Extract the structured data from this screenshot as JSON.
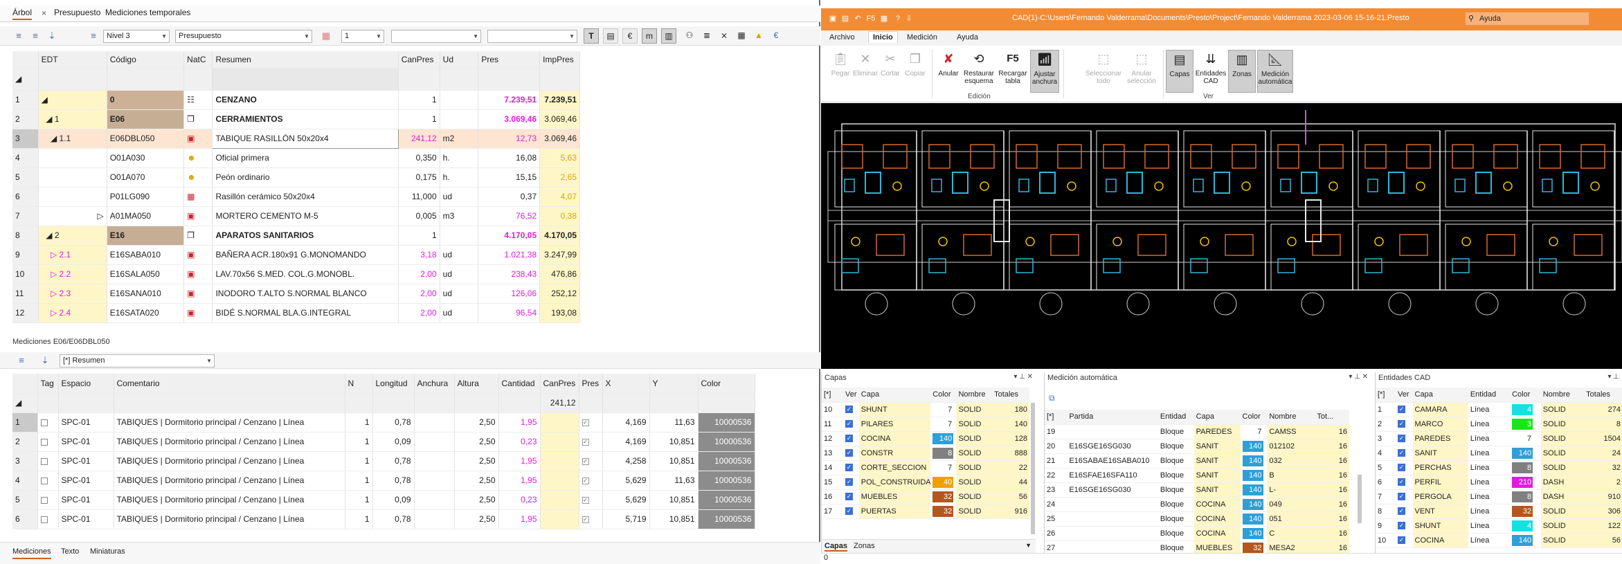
{
  "left": {
    "tabs": [
      {
        "label": "Árbol",
        "active": true
      },
      {
        "label": "Presupuesto",
        "active": false
      },
      {
        "label": "Mediciones temporales",
        "active": false
      }
    ],
    "close_glyph": "×",
    "toolbar": {
      "level_combo": "Nivel 3",
      "view_combo": "Presupuesto",
      "num_combo": "1",
      "empty_combo1": "",
      "empty_combo2": ""
    },
    "tree": {
      "headers": {
        "edt": "EDT",
        "codigo": "Código",
        "natc": "NatC",
        "resumen": "Resumen",
        "canpres": "CanPres",
        "ud": "Ud",
        "pres": "Pres",
        "imppres": "ImpPres"
      },
      "rows": [
        {
          "n": "1",
          "edt_num": "",
          "codigo": "0",
          "resumen": "CENZANO",
          "canpres": "1",
          "ud": "",
          "pres": "7.239,51",
          "imppres": "7.239,51"
        },
        {
          "n": "2",
          "edt_num": "1",
          "codigo": "E06",
          "resumen": "CERRAMIENTOS",
          "canpres": "1",
          "ud": "",
          "pres": "3.069,46",
          "imppres": "3.069,46"
        },
        {
          "n": "3",
          "edt_num": "1.1",
          "codigo": "E06DBL050",
          "resumen": "TABIQUE RASILLÓN 50x20x4",
          "canpres": "241,12",
          "ud": "m2",
          "pres": "12,73",
          "imppres": "3.069,46"
        },
        {
          "n": "4",
          "edt_num": "",
          "codigo": "O01A030",
          "resumen": "Oficial primera",
          "canpres": "0,350",
          "ud": "h.",
          "pres": "16,08",
          "imppres": "5,63"
        },
        {
          "n": "5",
          "edt_num": "",
          "codigo": "O01A070",
          "resumen": "Peón ordinario",
          "canpres": "0,175",
          "ud": "h.",
          "pres": "15,15",
          "imppres": "2,65"
        },
        {
          "n": "6",
          "edt_num": "",
          "codigo": "P01LG090",
          "resumen": "Rasillón cerámico 50x20x4",
          "canpres": "11,000",
          "ud": "ud",
          "pres": "0,37",
          "imppres": "4,07"
        },
        {
          "n": "7",
          "edt_num": "",
          "codigo": "A01MA050",
          "resumen": "MORTERO CEMENTO M-5",
          "canpres": "0,005",
          "ud": "m3",
          "pres": "76,52",
          "imppres": "0,38"
        },
        {
          "n": "8",
          "edt_num": "2",
          "codigo": "E16",
          "resumen": "APARATOS SANITARIOS",
          "canpres": "1",
          "ud": "",
          "pres": "4.170,05",
          "imppres": "4.170,05"
        },
        {
          "n": "9",
          "edt_num": "2.1",
          "codigo": "E16SABA010",
          "resumen": "BAÑERA ACR.180x91 G.MONOMANDO",
          "canpres": "3,18",
          "ud": "ud",
          "pres": "1.021,38",
          "imppres": "3.247,99"
        },
        {
          "n": "10",
          "edt_num": "2.2",
          "codigo": "E16SALA050",
          "resumen": "LAV.70x56 S.MED. COL.G.MONOBL.",
          "canpres": "2,00",
          "ud": "ud",
          "pres": "238,43",
          "imppres": "476,86"
        },
        {
          "n": "11",
          "edt_num": "2.3",
          "codigo": "E16SANA010",
          "resumen": "INODORO T.ALTO S.NORMAL BLANCO",
          "canpres": "2,00",
          "ud": "ud",
          "pres": "126,06",
          "imppres": "252,12"
        },
        {
          "n": "12",
          "edt_num": "2.4",
          "codigo": "E16SATA020",
          "resumen": "BIDÉ S.NORMAL BLA.G.INTEGRAL",
          "canpres": "2,00",
          "ud": "ud",
          "pres": "96,54",
          "imppres": "193,08"
        }
      ]
    },
    "mediciones": {
      "title": "Mediciones E06/E06DBL050",
      "combo": "[*] Resumen",
      "headers": {
        "tag": "Tag",
        "espacio": "Espacio",
        "comentario": "Comentario",
        "n": "N",
        "longitud": "Longitud",
        "anchura": "Anchura",
        "altura": "Altura",
        "cantidad": "Cantidad",
        "canpres": "CanPres",
        "pres": "Pres",
        "x": "X",
        "y": "Y",
        "color": "Color"
      },
      "canpres_total": "241,12",
      "rows": [
        {
          "n": "1",
          "espacio": "SPC-01",
          "comentario": "TABIQUES | Dormitorio principal / Cenzano | Línea",
          "nn": "1",
          "longitud": "0,78",
          "altura": "2,50",
          "cantidad": "1,95",
          "x": "4,169",
          "y": "11,63",
          "color": "10000536"
        },
        {
          "n": "2",
          "espacio": "SPC-01",
          "comentario": "TABIQUES | Dormitorio principal / Cenzano | Línea",
          "nn": "1",
          "longitud": "0,09",
          "altura": "2,50",
          "cantidad": "0,23",
          "x": "4,169",
          "y": "10,851",
          "color": "10000536"
        },
        {
          "n": "3",
          "espacio": "SPC-01",
          "comentario": "TABIQUES | Dormitorio principal / Cenzano | Línea",
          "nn": "1",
          "longitud": "0,78",
          "altura": "2,50",
          "cantidad": "1,95",
          "x": "4,258",
          "y": "10,851",
          "color": "10000536"
        },
        {
          "n": "4",
          "espacio": "SPC-01",
          "comentario": "TABIQUES | Dormitorio principal / Cenzano | Línea",
          "nn": "1",
          "longitud": "0,78",
          "altura": "2,50",
          "cantidad": "1,95",
          "x": "5,629",
          "y": "11,63",
          "color": "10000536"
        },
        {
          "n": "5",
          "espacio": "SPC-01",
          "comentario": "TABIQUES | Dormitorio principal / Cenzano | Línea",
          "nn": "1",
          "longitud": "0,09",
          "altura": "2,50",
          "cantidad": "0,23",
          "x": "5,629",
          "y": "10,851",
          "color": "10000536"
        },
        {
          "n": "6",
          "espacio": "SPC-01",
          "comentario": "TABIQUES | Dormitorio principal / Cenzano | Línea",
          "nn": "1",
          "longitud": "0,78",
          "altura": "2,50",
          "cantidad": "1,95",
          "x": "5,719",
          "y": "10,851",
          "color": "10000536"
        }
      ]
    },
    "bottom_tabs": [
      {
        "label": "Mediciones",
        "active": true
      },
      {
        "label": "Texto",
        "active": false
      },
      {
        "label": "Miniaturas",
        "active": false
      }
    ]
  },
  "right": {
    "title": "CAD(1)-C:\\Users\\Fernando Valderrama\\Documents\\Presto\\Project\\Fernando Valderrama 2023-03-06 15-16-21.Presto",
    "help_placeholder": "Ayuda",
    "ribbon_tabs": [
      {
        "label": "Archivo",
        "active": false
      },
      {
        "label": "Inicio",
        "active": true
      },
      {
        "label": "Medición",
        "active": false
      },
      {
        "label": "Ayuda",
        "active": false
      }
    ],
    "ribbon": {
      "pegar": "Pegar",
      "eliminar": "Eliminar",
      "cortar": "Cortar",
      "copiar": "Copiar",
      "anular": "Anular",
      "restaurar": "Restaurar",
      "restaurar2": "esquema",
      "recargar": "Recargar",
      "recargar2": "tabla",
      "ajustar": "Ajustar",
      "ajustar2": "anchura",
      "f5": "F5",
      "seleccionar": "Seleccionar",
      "seleccionar2": "todo",
      "anular_sel": "Anular",
      "anular_sel2": "selección",
      "capas": "Capas",
      "entidades": "Entidades",
      "entidades2": "CAD",
      "zonas": "Zonas",
      "medicion": "Medición",
      "medicion2": "automática",
      "grp_edicion": "Edición",
      "grp_ver": "Ver"
    },
    "capas_panel": {
      "title": "Capas",
      "headers": {
        "star": "[*]",
        "ver": "Ver",
        "capa": "Capa",
        "color": "Color",
        "nombre": "Nombre",
        "totales": "Totales"
      },
      "rows": [
        {
          "n": "10",
          "capa": "SHUNT",
          "color": "7",
          "sw": "",
          "nombre": "SOLID",
          "tot": "180"
        },
        {
          "n": "11",
          "capa": "PILARES",
          "color": "7",
          "sw": "",
          "nombre": "SOLID",
          "tot": "140"
        },
        {
          "n": "12",
          "capa": "COCINA",
          "color": "140",
          "sw": "#2f9fd8",
          "nombre": "SOLID",
          "tot": "128"
        },
        {
          "n": "13",
          "capa": "CONSTR",
          "color": "8",
          "sw": "#808080",
          "nombre": "SOLID",
          "tot": "888"
        },
        {
          "n": "14",
          "capa": "CORTE_SECCION",
          "color": "7",
          "sw": "",
          "nombre": "SOLID",
          "tot": "22"
        },
        {
          "n": "15",
          "capa": "POL_CONSTRUIDA",
          "color": "40",
          "sw": "#f0a000",
          "nombre": "SOLID",
          "tot": "44"
        },
        {
          "n": "16",
          "capa": "MUEBLES",
          "color": "32",
          "sw": "#b5561f",
          "nombre": "SOLID",
          "tot": "56"
        },
        {
          "n": "17",
          "capa": "PUERTAS",
          "color": "32",
          "sw": "#b5561f",
          "nombre": "SOLID",
          "tot": "916"
        }
      ],
      "tabs": [
        {
          "label": "Capas",
          "active": true
        },
        {
          "label": "Zonas",
          "active": false
        }
      ]
    },
    "med_auto_panel": {
      "title": "Medición automática",
      "headers": {
        "star": "[*]",
        "partida": "Partida",
        "entidad": "Entidad",
        "capa": "Capa",
        "color": "Color",
        "nombre": "Nombre",
        "tot": "Tot..."
      },
      "rows": [
        {
          "n": "19",
          "partida": "",
          "entidad": "Bloque",
          "capa": "PAREDES",
          "color": "7",
          "sw": "",
          "nombre": "CAMSS",
          "tot": "16"
        },
        {
          "n": "20",
          "partida": "E16SGE16SG030",
          "entidad": "Bloque",
          "capa": "SANIT",
          "color": "140",
          "sw": "#2f9fd8",
          "nombre": "012102",
          "tot": "16"
        },
        {
          "n": "21",
          "partida": "E16SABAE16SABA010",
          "entidad": "Bloque",
          "capa": "SANIT",
          "color": "140",
          "sw": "#2f9fd8",
          "nombre": "032",
          "tot": "16"
        },
        {
          "n": "22",
          "partida": "E16SFAE16SFA110",
          "entidad": "Bloque",
          "capa": "SANIT",
          "color": "140",
          "sw": "#2f9fd8",
          "nombre": "B",
          "tot": "16"
        },
        {
          "n": "23",
          "partida": "E16SGE16SG030",
          "entidad": "Bloque",
          "capa": "SANIT",
          "color": "140",
          "sw": "#2f9fd8",
          "nombre": "L-",
          "tot": "16"
        },
        {
          "n": "24",
          "partida": "",
          "entidad": "Bloque",
          "capa": "COCINA",
          "color": "140",
          "sw": "#2f9fd8",
          "nombre": "049",
          "tot": "16"
        },
        {
          "n": "25",
          "partida": "",
          "entidad": "Bloque",
          "capa": "COCINA",
          "color": "140",
          "sw": "#2f9fd8",
          "nombre": "051",
          "tot": "16"
        },
        {
          "n": "26",
          "partida": "",
          "entidad": "Bloque",
          "capa": "COCINA",
          "color": "140",
          "sw": "#2f9fd8",
          "nombre": "C",
          "tot": "16"
        },
        {
          "n": "27",
          "partida": "",
          "entidad": "Bloque",
          "capa": "MUEBLES",
          "color": "32",
          "sw": "#b5561f",
          "nombre": "MESA2",
          "tot": "16"
        }
      ]
    },
    "entidades_panel": {
      "title": "Entidades CAD",
      "headers": {
        "star": "[*]",
        "ver": "Ver",
        "capa": "Capa",
        "entidad": "Entidad",
        "color": "Color",
        "nombre": "Nombre",
        "totales": "Totales"
      },
      "rows": [
        {
          "n": "1",
          "capa": "CAMARA",
          "entidad": "Línea",
          "color": "4",
          "sw": "#17e0e0",
          "nombre": "SOLID",
          "tot": "274"
        },
        {
          "n": "2",
          "capa": "MARCO",
          "entidad": "Línea",
          "color": "3",
          "sw": "#19e619",
          "nombre": "SOLID",
          "tot": "8"
        },
        {
          "n": "3",
          "capa": "PAREDES",
          "entidad": "Línea",
          "color": "7",
          "sw": "",
          "nombre": "SOLID",
          "tot": "1504"
        },
        {
          "n": "4",
          "capa": "SANIT",
          "entidad": "Línea",
          "color": "140",
          "sw": "#2f9fd8",
          "nombre": "SOLID",
          "tot": "24"
        },
        {
          "n": "5",
          "capa": "PERCHAS",
          "entidad": "Línea",
          "color": "8",
          "sw": "#808080",
          "nombre": "SOLID",
          "tot": "32"
        },
        {
          "n": "6",
          "capa": "PERFIL",
          "entidad": "Línea",
          "color": "210",
          "sw": "#e01be0",
          "nombre": "DASH",
          "tot": "2"
        },
        {
          "n": "7",
          "capa": "PERGOLA",
          "entidad": "Línea",
          "color": "8",
          "sw": "#808080",
          "nombre": "DASH",
          "tot": "910"
        },
        {
          "n": "8",
          "capa": "VENT",
          "entidad": "Línea",
          "color": "32",
          "sw": "#b5561f",
          "nombre": "SOLID",
          "tot": "306"
        },
        {
          "n": "9",
          "capa": "SHUNT",
          "entidad": "Línea",
          "color": "4",
          "sw": "#17e0e0",
          "nombre": "SOLID",
          "tot": "122"
        },
        {
          "n": "10",
          "capa": "COCINA",
          "entidad": "Línea",
          "color": "140",
          "sw": "#2f9fd8",
          "nombre": "SOLID",
          "tot": "56"
        }
      ]
    },
    "status": "0"
  }
}
